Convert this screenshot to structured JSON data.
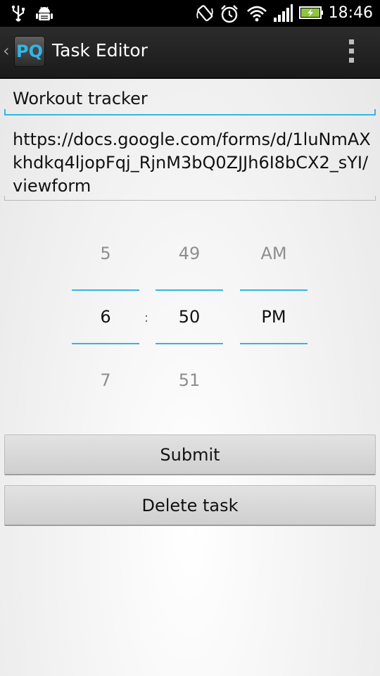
{
  "status_bar": {
    "time": "18:46",
    "icons": [
      "usb-icon",
      "android-debug-icon",
      "rotation-icon",
      "alarm-icon",
      "wifi-icon",
      "signal-icon",
      "battery-charging-icon"
    ]
  },
  "action_bar": {
    "app_icon_text": "PQ",
    "title": "Task Editor"
  },
  "form": {
    "name_value": "Workout tracker",
    "url_value": "https://docs.google.com/forms/d/1luNmAXkhdkq4ljopFqj_RjnM3bQ0ZJJh6I8bCX2_sYI/viewform"
  },
  "time_picker": {
    "hour": {
      "prev": "5",
      "current": "6",
      "next": "7"
    },
    "separator": ":",
    "minute": {
      "prev": "49",
      "current": "50",
      "next": "51"
    },
    "ampm": {
      "prev": "AM",
      "current": "PM"
    }
  },
  "buttons": {
    "submit_label": "Submit",
    "delete_label": "Delete task"
  },
  "colors": {
    "accent": "#33b5e5",
    "action_bar": "#222222",
    "status_bar": "#000000"
  }
}
